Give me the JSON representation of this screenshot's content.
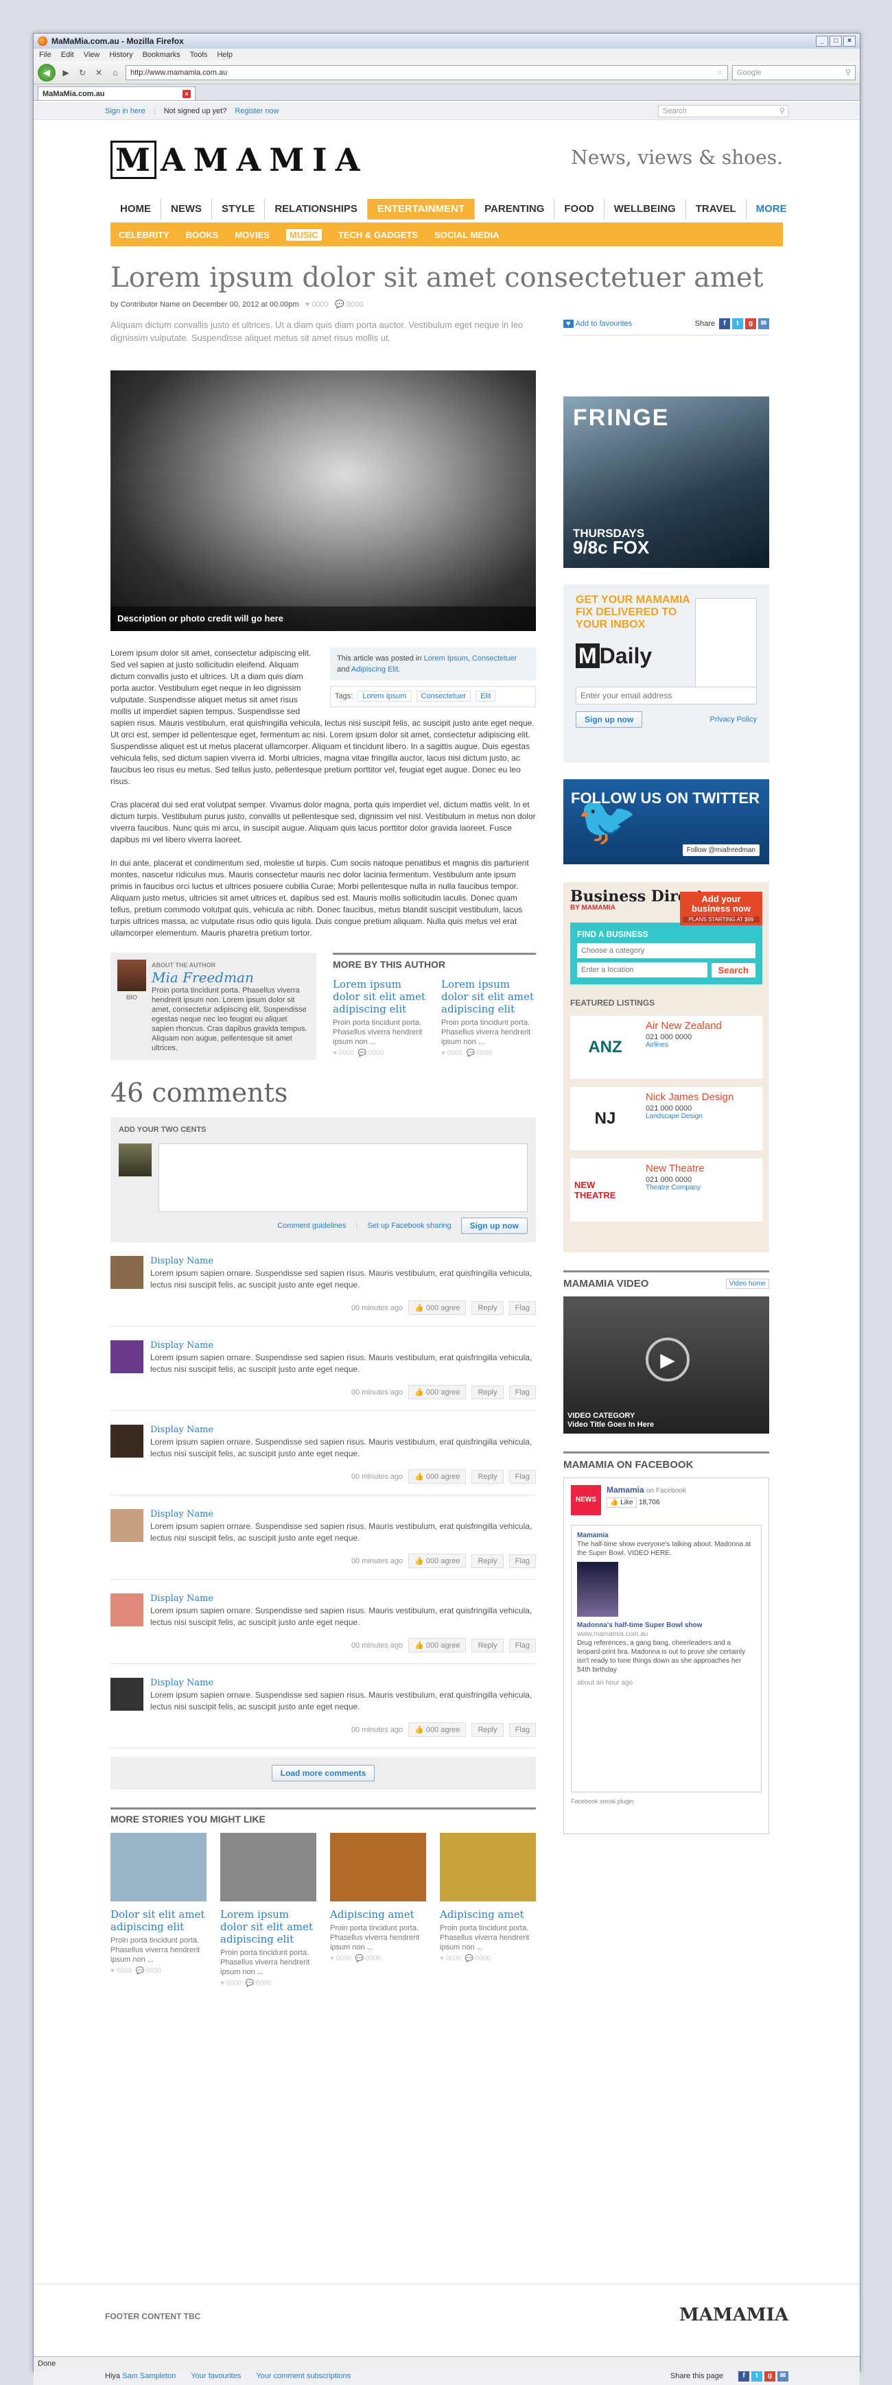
{
  "browser": {
    "window_title": "MaMaMia.com.au - Mozilla Firefox",
    "menu": [
      "File",
      "Edit",
      "View",
      "History",
      "Bookmarks",
      "Tools",
      "Help"
    ],
    "url": "http://www.mamamia.com.au",
    "search_placeholder": "Google",
    "tab_label": "MaMaMia.com.au",
    "status": "Done"
  },
  "topstrip": {
    "sign_in": "Sign in here",
    "not_signed_up": "Not signed up yet?",
    "register": "Register now",
    "search_placeholder": "Search"
  },
  "header": {
    "logo_letters": [
      "M",
      "A",
      "M",
      "A",
      "M",
      "I",
      "A"
    ],
    "tagline": "News, views & shoes."
  },
  "nav": {
    "items": [
      "HOME",
      "NEWS",
      "STYLE",
      "RELATIONSHIPS",
      "ENTERTAINMENT",
      "PARENTING",
      "FOOD",
      "WELLBEING",
      "TRAVEL"
    ],
    "more": "MORE",
    "active": "ENTERTAINMENT",
    "sub": [
      "CELEBRITY",
      "BOOKS",
      "MOVIES",
      "MUSIC",
      "TECH & GADGETS",
      "SOCIAL MEDIA"
    ],
    "sub_active": "MUSIC"
  },
  "article": {
    "title": "Lorem ipsum dolor sit amet consectetuer amet",
    "byline": "by Contributor Name on December 00, 2012 at 00.00pm",
    "likes": "0000",
    "comments": "0000",
    "lead": "Aliquam dictum convallis justo et ultrices. Ut a diam quis diam porta auctor. Vestibulum eget neque in leo dignissim vulputate. Suspendisse aliquet metus sit amet risus mollis ut.",
    "add_favourites": "Add to favourites",
    "share_label": "Share",
    "photo_credit": "Description or photo credit will go here",
    "posted_in_prefix": "This article was posted in",
    "posted_in": [
      "Lorem Ipsum",
      "Consectetuer",
      "Adipiscing Elit"
    ],
    "tags_label": "Tags:",
    "tags": [
      "Lorem Ipsum",
      "Consectetuer",
      "Elit"
    ],
    "paragraphs": [
      "Lorem ipsum dolor sit amet, consectetur adipiscing elit. Sed vel sapien at justo sollicitudin eleifend. Aliquam dictum convallis justo et ultrices. Ut a diam quis diam porta auctor. Vestibulum eget neque in leo dignissim vulputate. Suspendisse aliquet metus sit amet risus mollis ut imperdiet sapien tempus. Suspendisse sed sapien risus. Mauris vestibulum, erat quisfringilla vehicula, lectus nisi suscipit felis, ac suscipit justo ante eget neque. Ut orci est, semper id pellentesque eget, fermentum ac nisi. Lorem ipsum dolor sit amet, consectetur adipiscing elit. Suspendisse aliquet est ut metus placerat ullamcorper. Aliquam et tincidunt libero. In a sagittis augue. Duis egestas vehicula felis, sed dictum sapien viverra id. Morbi ultricies, magna vitae fringilla auctor, lacus nisi dictum justo, ac faucibus leo risus eu metus. Sed tellus justo, pellentesque pretium porttitor vel, feugiat eget augue. Donec eu leo risus.",
      "Cras placerat dui sed erat volutpat semper. Vivamus dolor magna, porta quis imperdiet vel, dictum mattis velit. In et dictum turpis. Vestibulum purus justo, convallis ut pellentesque sed, dignissim vel nisl. Vestibulum in metus non dolor viverra faucibus. Nunc quis mi arcu, in suscipit augue. Aliquam quis lacus porttitor dolor gravida laoreet. Fusce dapibus mi vel libero viverra laoreet.",
      "In dui ante, placerat et condimentum sed, molestie ut turpis. Cum sociis natoque penatibus et magnis dis parturient montes, nascetur ridiculus mus. Mauris consectetur mauris nec dolor lacinia fermentum. Vestibulum ante ipsum primis in faucibus orci luctus et ultrices posuere cubilia Curae; Morbi pellentesque nulla in nulla faucibus tempor. Aliquam justo metus, ultricies sit amet ultrices et, dapibus sed est. Mauris mollis sollicitudin iaculis. Donec quam tellus, pretium commodo volutpat quis, vehicula ac nibh. Donec faucibus, metus blandit suscipit vestibulum, lacus turpis ultrices massa, ac vulputate risus odio quis ligula. Duis congue pretium aliquam. Nulla quis metus vel erat ullamcorper elementum. Mauris pharetra pretium tortor."
    ]
  },
  "author": {
    "label": "About the author",
    "name": "Mia Freedman",
    "bio_label": "BIO",
    "bio": "Proin porta tincidunt porta. Phasellus viverra hendrerit ipsum non. Lorem ipsum dolor sit amet, consectetur adipiscing elit. Suspendisse egestas neque nec leo feugiat eu aliquet sapien rhoncus. Cras dapibus gravida tempus. Aliquam non augue, pellentesque sit amet ultrices."
  },
  "more_by_author": {
    "heading": "More by this author",
    "items": [
      {
        "title": "Lorem ipsum dolor sit elit amet adipiscing elit",
        "text": "Proin porta tincidunt porta. Phasellus viverra hendrerit ipsum non ...",
        "likes": "0000",
        "comments": "0000"
      },
      {
        "title": "Lorem ipsum dolor sit elit amet adipiscing elit",
        "text": "Proin porta tincidunt porta. Phasellus viverra hendrerit ipsum non ...",
        "likes": "0000",
        "comments": "0000"
      }
    ]
  },
  "comments": {
    "count_label": "46 comments",
    "add_label": "Add your two cents",
    "guidelines": "Comment guidelines",
    "fb_sharing": "Set up Facebook sharing",
    "sign_up": "Sign up now",
    "reply": "Reply",
    "flag": "Flag",
    "load_more": "Load more comments",
    "items": [
      {
        "name": "Display Name",
        "text": "Lorem ipsum sapien ornare. Suspendisse sed sapien risus. Mauris vestibulum, erat quisfringilla vehicula, lectus nisi suscipit felis, ac suscipit justo ante eget neque.",
        "time": "00 minutes ago",
        "agree": "000 agree",
        "color": "#8a6a4a"
      },
      {
        "name": "Display Name",
        "text": "Lorem ipsum sapien ornare. Suspendisse sed sapien risus. Mauris vestibulum, erat quisfringilla vehicula, lectus nisi suscipit felis, ac suscipit justo ante eget neque.",
        "time": "00 minutes ago",
        "agree": "000 agree",
        "color": "#6a3a8a"
      },
      {
        "name": "Display Name",
        "text": "Lorem ipsum sapien ornare. Suspendisse sed sapien risus. Mauris vestibulum, erat quisfringilla vehicula, lectus nisi suscipit felis, ac suscipit justo ante eget neque.",
        "time": "00 minutes ago",
        "agree": "000 agree",
        "color": "#3a2a20"
      },
      {
        "name": "Display Name",
        "text": "Lorem ipsum sapien ornare. Suspendisse sed sapien risus. Mauris vestibulum, erat quisfringilla vehicula, lectus nisi suscipit felis, ac suscipit justo ante eget neque.",
        "time": "00 minutes ago",
        "agree": "000 agree",
        "color": "#c8a080"
      },
      {
        "name": "Display Name",
        "text": "Lorem ipsum sapien ornare. Suspendisse sed sapien risus. Mauris vestibulum, erat quisfringilla vehicula, lectus nisi suscipit felis, ac suscipit justo ante eget neque.",
        "time": "00 minutes ago",
        "agree": "000 agree",
        "color": "#e08a7a"
      },
      {
        "name": "Display Name",
        "text": "Lorem ipsum sapien ornare. Suspendisse sed sapien risus. Mauris vestibulum, erat quisfringilla vehicula, lectus nisi suscipit felis, ac suscipit justo ante eget neque.",
        "time": "00 minutes ago",
        "agree": "000 agree",
        "color": "#333333"
      }
    ]
  },
  "more_stories": {
    "heading": "More stories you might like",
    "items": [
      {
        "title": "Dolor sit elit amet adipiscing elit",
        "text": "Proin porta tincidunt porta. Phasellus viverra hendrerit ipsum non ...",
        "likes": "0000",
        "comments": "0000",
        "color": "#9ab4c8"
      },
      {
        "title": "Lorem ipsum dolor sit elit amet adipiscing elit",
        "text": "Proin porta tincidunt porta. Phasellus viverra hendrerit ipsum non ...",
        "likes": "0000",
        "comments": "0000",
        "color": "#888888"
      },
      {
        "title": "Adipiscing amet",
        "text": "Proin porta tincidunt porta. Phasellus viverra hendrerit ipsum non ...",
        "likes": "0000",
        "comments": "0000",
        "color": "#b06a2a"
      },
      {
        "title": "Adipiscing amet",
        "text": "Proin porta tincidunt porta. Phasellus viverra hendrerit ipsum non ...",
        "likes": "0000",
        "comments": "0000",
        "color": "#c8a23a"
      }
    ]
  },
  "sidebar": {
    "ad": {
      "title": "FRINGE",
      "line1": "THURSDAYS",
      "line2": "9/8c FOX"
    },
    "newsletter": {
      "heading": "GET YOUR MAMAMIA FIX DELIVERED TO YOUR INBOX",
      "brand": "Daily",
      "placeholder": "Enter your email address",
      "sign_up": "Sign up now",
      "privacy": "Privacy Policy"
    },
    "twitter": {
      "heading": "FOLLOW US ON TWITTER",
      "button": "Follow @miafreedman"
    },
    "business": {
      "title": "Business Directory",
      "by": "BY MAMAMIA",
      "add": "Add your business now",
      "add_sub": "PLANS STARTING AT $99",
      "find": "FIND A BUSINESS",
      "category_placeholder": "Choose a category",
      "location_placeholder": "Enter a location",
      "search": "Search",
      "featured": "Featured listings",
      "listings": [
        {
          "name": "Air New Zealand",
          "phone": "021 000 0000",
          "category": "Airlines",
          "logo": "ANZ"
        },
        {
          "name": "Nick James Design",
          "phone": "021 000 0000",
          "category": "Landscape Design",
          "logo": "NJ"
        },
        {
          "name": "New Theatre",
          "phone": "021 000 0000",
          "category": "Theatre Company",
          "logo": "NEW THEATRE"
        }
      ]
    },
    "video": {
      "heading": "Mamamia video",
      "home": "Video home",
      "category": "VIDEO CATEGORY",
      "title": "Video Title Goes In Here"
    },
    "facebook": {
      "heading": "Mamamia on Facebook",
      "page": "Mamamia",
      "on": "on Facebook",
      "like": "Like",
      "likes": "18,706",
      "post_author": "Mamamia",
      "post_text": "The half-time show everyone's talking about. Madonna at the Super Bowl. VIDEO HERE.",
      "link": "www.mamamia.com.au",
      "link_title": "Madonna's half-time Super Bowl show",
      "link_desc": "Drug references, a gang bang, cheerleaders and a leopard-print bra. Madonna is out to prove she certainly isn't ready to tone things down as she approaches her 54th birthday",
      "time": "about an hour ago",
      "plugin": "Facebook social plugin"
    }
  },
  "footer": {
    "text": "FOOTER CONTENT TBC",
    "logo": "MAMAMIA",
    "greeting": "Hiya",
    "user": "Sam Sampleton",
    "favourites": "Your favourites",
    "subscriptions": "Your comment subscriptions",
    "share": "Share this page"
  },
  "colors": {
    "accent": "#f9b233",
    "link": "#2a7fc6"
  }
}
